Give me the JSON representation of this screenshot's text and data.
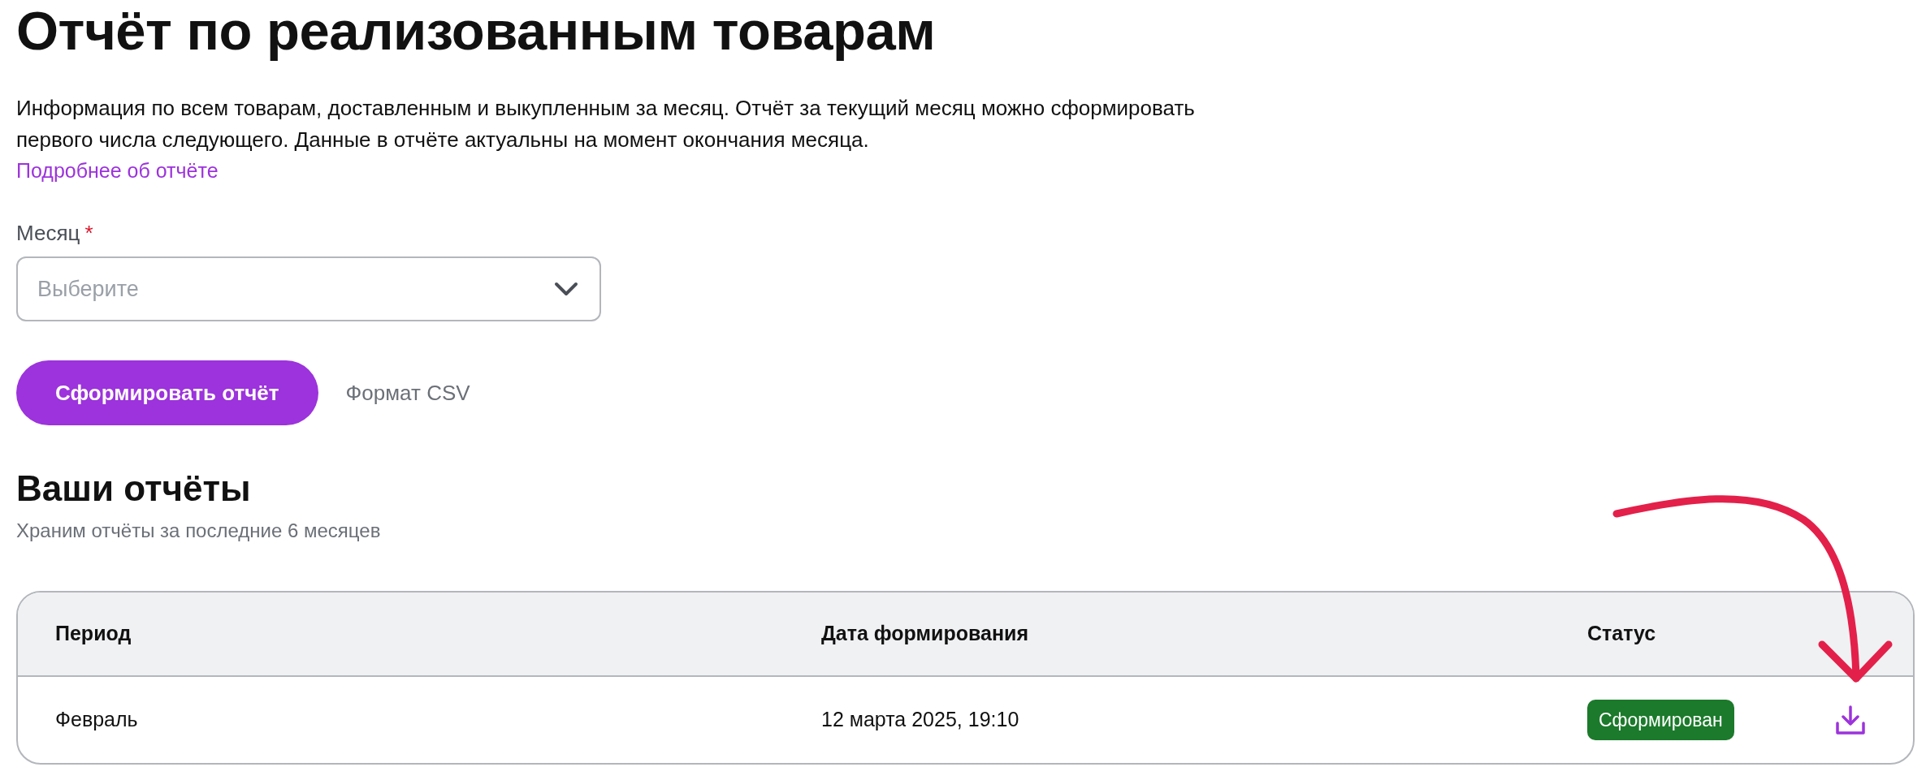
{
  "title": "Отчёт по реализованным товарам",
  "description": "Информация по всем товарам, доставленным и выкупленным за месяц. Отчёт за текущий месяц можно сформировать первого числа следующего. Данные в отчёте актуальны на момент окончания месяца.",
  "more_link": "Подробнее об отчёте",
  "month_field": {
    "label": "Месяц",
    "required_mark": "*",
    "placeholder": "Выберите"
  },
  "generate_button": "Сформировать отчёт",
  "format_note": "Формат CSV",
  "reports": {
    "title": "Ваши отчёты",
    "subtitle": "Храним отчёты за последние 6 месяцев",
    "columns": [
      "Период",
      "Дата формирования",
      "Статус"
    ],
    "rows": [
      {
        "period": "Февраль",
        "date": "12 марта 2025, 19:10",
        "status": {
          "label": "Сформирован",
          "kind": "ready"
        }
      }
    ]
  }
}
